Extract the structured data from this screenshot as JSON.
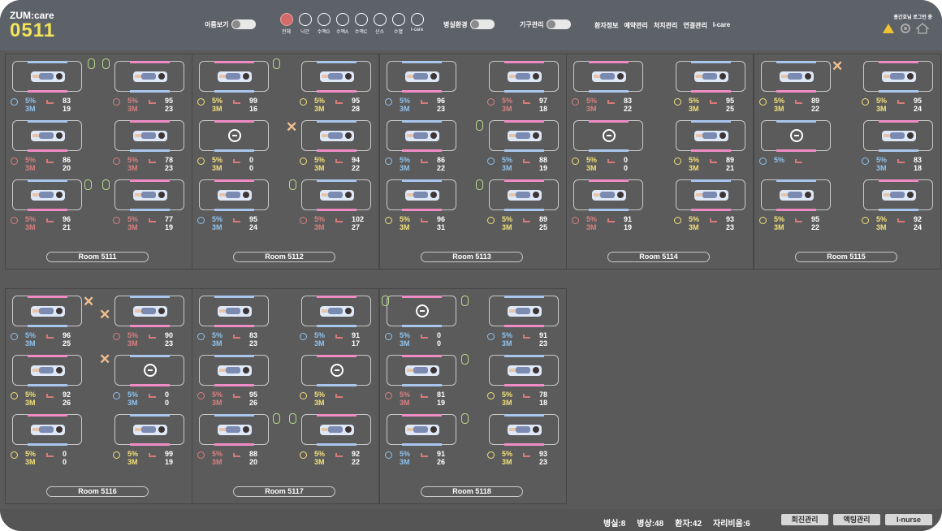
{
  "header": {
    "brand": "ZUM:care",
    "ward": "0511",
    "name_toggle_label": "이름보기",
    "room_env_label": "병실환경",
    "device_mgmt_label": "기구관리",
    "login_status": "홍간호님 로그인 중"
  },
  "filters": [
    "전체",
    "낙간",
    "수액G",
    "수액A",
    "수액C",
    "산소",
    "수혈",
    "I-care"
  ],
  "menu": [
    "환자정보",
    "예약관리",
    "처치관리",
    "연결관리",
    "I-care"
  ],
  "rooms": [
    {
      "name": "Room 5111",
      "beds": [
        {
          "pct": "5%",
          "mon": "3M",
          "v1": "83",
          "v2": "19",
          "color": "blue"
        },
        {
          "pct": "5%",
          "mon": "3M",
          "v1": "95",
          "v2": "23",
          "color": "red"
        },
        {
          "pct": "5%",
          "mon": "3M",
          "v1": "86",
          "v2": "20",
          "color": "red"
        },
        {
          "pct": "5%",
          "mon": "3M",
          "v1": "78",
          "v2": "23",
          "color": "red"
        },
        {
          "pct": "5%",
          "mon": "3M",
          "v1": "96",
          "v2": "21",
          "color": "red"
        },
        {
          "pct": "5%",
          "mon": "3M",
          "v1": "77",
          "v2": "19",
          "color": "red"
        }
      ]
    },
    {
      "name": "Room 5112",
      "beds": [
        {
          "pct": "5%",
          "mon": "3M",
          "v1": "99",
          "v2": "16",
          "color": "yel"
        },
        {
          "pct": "5%",
          "mon": "3M",
          "v1": "95",
          "v2": "28",
          "color": "yel"
        },
        {
          "pct": "5%",
          "mon": "3M",
          "v1": "0",
          "v2": "0",
          "color": "yel"
        },
        {
          "pct": "5%",
          "mon": "3M",
          "v1": "94",
          "v2": "22",
          "color": "yel"
        },
        {
          "pct": "5%",
          "mon": "3M",
          "v1": "95",
          "v2": "24",
          "color": "blue"
        },
        {
          "pct": "5%",
          "mon": "3M",
          "v1": "102",
          "v2": "27",
          "color": "red"
        }
      ]
    },
    {
      "name": "Room 5113",
      "beds": [
        {
          "pct": "5%",
          "mon": "3M",
          "v1": "96",
          "v2": "23",
          "color": "blue"
        },
        {
          "pct": "5%",
          "mon": "3M",
          "v1": "97",
          "v2": "18",
          "color": "red"
        },
        {
          "pct": "5%",
          "mon": "3M",
          "v1": "86",
          "v2": "22",
          "color": "blue"
        },
        {
          "pct": "5%",
          "mon": "3M",
          "v1": "88",
          "v2": "19",
          "color": "blue"
        },
        {
          "pct": "5%",
          "mon": "3M",
          "v1": "96",
          "v2": "31",
          "color": "yel"
        },
        {
          "pct": "5%",
          "mon": "3M",
          "v1": "89",
          "v2": "25",
          "color": "yel"
        }
      ]
    },
    {
      "name": "Room 5114",
      "beds": [
        {
          "pct": "5%",
          "mon": "3M",
          "v1": "83",
          "v2": "22",
          "color": "red"
        },
        {
          "pct": "5%",
          "mon": "3M",
          "v1": "95",
          "v2": "25",
          "color": "yel"
        },
        {
          "pct": "5%",
          "mon": "3M",
          "v1": "0",
          "v2": "0",
          "color": "yel"
        },
        {
          "pct": "5%",
          "mon": "3M",
          "v1": "89",
          "v2": "21",
          "color": "yel"
        },
        {
          "pct": "5%",
          "mon": "3M",
          "v1": "91",
          "v2": "19",
          "color": "red"
        },
        {
          "pct": "5%",
          "mon": "3M",
          "v1": "93",
          "v2": "23",
          "color": "yel"
        }
      ]
    },
    {
      "name": "Room 5115",
      "beds": [
        {
          "pct": "5%",
          "mon": "3M",
          "v1": "89",
          "v2": "22",
          "color": "yel"
        },
        {
          "pct": "5%",
          "mon": "3M",
          "v1": "95",
          "v2": "24",
          "color": "yel"
        },
        {
          "pct": "5%",
          "mon": "",
          "v1": "",
          "v2": "",
          "color": "blue"
        },
        {
          "pct": "5%",
          "mon": "3M",
          "v1": "83",
          "v2": "18",
          "color": "blue"
        },
        {
          "pct": "5%",
          "mon": "3M",
          "v1": "95",
          "v2": "22",
          "color": "yel"
        },
        {
          "pct": "5%",
          "mon": "3M",
          "v1": "92",
          "v2": "24",
          "color": "yel"
        }
      ]
    },
    {
      "name": "Room 5116",
      "beds": [
        {
          "pct": "5%",
          "mon": "3M",
          "v1": "96",
          "v2": "25",
          "color": "blue"
        },
        {
          "pct": "5%",
          "mon": "3M",
          "v1": "90",
          "v2": "23",
          "color": "red"
        },
        {
          "pct": "5%",
          "mon": "3M",
          "v1": "92",
          "v2": "26",
          "color": "yel"
        },
        {
          "pct": "5%",
          "mon": "3M",
          "v1": "0",
          "v2": "0",
          "color": "blue"
        },
        {
          "pct": "5%",
          "mon": "3M",
          "v1": "0",
          "v2": "0",
          "color": "yel"
        },
        {
          "pct": "5%",
          "mon": "3M",
          "v1": "99",
          "v2": "19",
          "color": "yel"
        }
      ]
    },
    {
      "name": "Room 5117",
      "beds": [
        {
          "pct": "5%",
          "mon": "3M",
          "v1": "83",
          "v2": "23",
          "color": "blue"
        },
        {
          "pct": "5%",
          "mon": "3M",
          "v1": "91",
          "v2": "17",
          "color": "blue"
        },
        {
          "pct": "5%",
          "mon": "3M",
          "v1": "95",
          "v2": "26",
          "color": "red"
        },
        {
          "pct": "5%",
          "mon": "3M",
          "v1": "",
          "v2": "",
          "color": "yel"
        },
        {
          "pct": "5%",
          "mon": "3M",
          "v1": "88",
          "v2": "20",
          "color": "red"
        },
        {
          "pct": "5%",
          "mon": "3M",
          "v1": "92",
          "v2": "22",
          "color": "yel"
        }
      ]
    },
    {
      "name": "Room 5118",
      "beds": [
        {
          "pct": "5%",
          "mon": "3M",
          "v1": "0",
          "v2": "0",
          "color": "blue"
        },
        {
          "pct": "5%",
          "mon": "3M",
          "v1": "91",
          "v2": "23",
          "color": "blue"
        },
        {
          "pct": "5%",
          "mon": "3M",
          "v1": "81",
          "v2": "19",
          "color": "red"
        },
        {
          "pct": "5%",
          "mon": "3M",
          "v1": "78",
          "v2": "18",
          "color": "yel"
        },
        {
          "pct": "5%",
          "mon": "3M",
          "v1": "91",
          "v2": "26",
          "color": "blue"
        },
        {
          "pct": "5%",
          "mon": "3M",
          "v1": "93",
          "v2": "23",
          "color": "yel"
        }
      ]
    }
  ],
  "footer": {
    "rooms": "병실:8",
    "beds": "병상:48",
    "patients": "환자:42",
    "vacancy": "자리비움:6",
    "btn1": "회진관리",
    "btn2": "액팅관리",
    "btn3": "I-nurse"
  },
  "colors": {
    "accent": "#f1e35a",
    "red": "#d98080",
    "yellow": "#f1e07a",
    "blue": "#8fc3ef",
    "pink_bar": "#f08cc5",
    "blue_bar": "#a9c7ee"
  }
}
